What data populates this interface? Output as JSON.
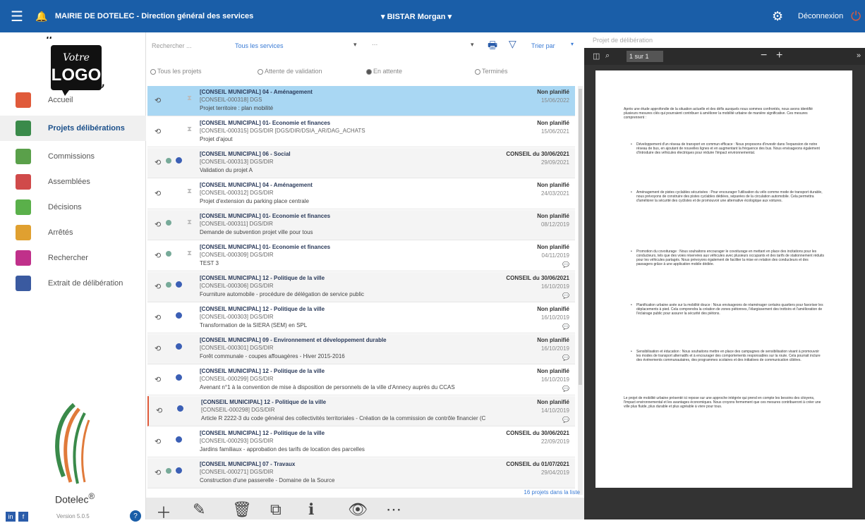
{
  "topbar": {
    "title": "MAIRIE DE DOTELEC - Direction général des services",
    "user": "BISTAR Morgan",
    "logout": "Déconnexion"
  },
  "logo": {
    "line1": "Votre",
    "line2": "LOGO"
  },
  "nav": [
    {
      "label": "Accueil",
      "icon": "home-icon",
      "color": "#e05a3a"
    },
    {
      "label": "Projets délibérations",
      "icon": "factory-icon",
      "color": "#3a8a4a",
      "active": true
    },
    {
      "label": "Commissions",
      "icon": "group-icon",
      "color": "#5aa04a"
    },
    {
      "label": "Assemblées",
      "icon": "assembly-icon",
      "color": "#d04a4a"
    },
    {
      "label": "Décisions",
      "icon": "decision-icon",
      "color": "#5ab04a"
    },
    {
      "label": "Arrêtés",
      "icon": "arrete-icon",
      "color": "#e0a030"
    },
    {
      "label": "Rechercher",
      "icon": "search-icon",
      "color": "#c0308a"
    },
    {
      "label": "Extrait de délibération",
      "icon": "extract-icon",
      "color": "#3a5aa0"
    }
  ],
  "brand": "Dotelec",
  "version": "Version 5.0.5",
  "filters": {
    "search_placeholder": "Rechercher ...",
    "services": "Tous les services",
    "sort": "Trier par",
    "radios": [
      {
        "label": "Tous les projets",
        "checked": false
      },
      {
        "label": "Attente de validation",
        "checked": false
      },
      {
        "label": "En attente",
        "checked": true
      },
      {
        "label": "Terminés",
        "checked": false
      }
    ]
  },
  "rows": [
    {
      "t1": "[CONSEIL MUNICIPAL] 04 - Aménagement",
      "t2": "[CONSEIL-000318] DGS",
      "t3": "Projet territoire : plan mobilité",
      "st": "Non planifié",
      "dt": "15/06/2022",
      "sel": true,
      "i2": false,
      "i3": false,
      "hour": true
    },
    {
      "t1": "[CONSEIL MUNICIPAL] 01- Economie et finances",
      "t2": "[CONSEIL-000315] DGS/DIR [DGS/DIR/DSIA_AR/DAG_ACHATS",
      "t3": "Projet d'ajout",
      "st": "Non planifié",
      "dt": "15/06/2021",
      "i2": false,
      "i3": false,
      "hour": true
    },
    {
      "t1": "[CONSEIL MUNICIPAL] 06 - Social",
      "t2": "[CONSEIL-000313] DGS/DIR",
      "t3": "Validation du projet A",
      "st": "CONSEIL du 30/06/2021",
      "dt": "29/09/2021",
      "alt": true,
      "i2": true,
      "i3": true,
      "hour": false
    },
    {
      "t1": "[CONSEIL MUNICIPAL] 04 - Aménagement",
      "t2": "[CONSEIL-000312] DGS/DIR",
      "t3": "Projet d'extension du parking place centrale",
      "st": "Non planifié",
      "dt": "24/03/2021",
      "i2": false,
      "i3": false,
      "hour": true
    },
    {
      "t1": "[CONSEIL MUNICIPAL] 01- Economie et finances",
      "t2": "[CONSEIL-000311] DGS/DIR",
      "t3": "Demande de subvention projet ville pour tous",
      "st": "Non planifié",
      "dt": "08/12/2019",
      "alt": true,
      "i2": true,
      "i3": false,
      "hour": true
    },
    {
      "t1": "[CONSEIL MUNICIPAL] 01- Economie et finances",
      "t2": "[CONSEIL-000309] DGS/DIR",
      "t3": "TEST 3",
      "st": "Non planifié",
      "dt": "04/11/2019",
      "cm": true,
      "i2": true,
      "i3": false,
      "hour": true
    },
    {
      "t1": "[CONSEIL MUNICIPAL] 12 - Politique de la ville",
      "t2": "[CONSEIL-000306] DGS/DIR",
      "t3": "Fourniture automobile - procédure de délégation de service public",
      "st": "CONSEIL du 30/06/2021",
      "dt": "16/10/2019",
      "cm": true,
      "alt": true,
      "i2": true,
      "i3": true,
      "hour": false
    },
    {
      "t1": "[CONSEIL MUNICIPAL] 12 - Politique de la ville",
      "t2": "[CONSEIL-000303] DGS/DIR",
      "t3": "Transformation de la SIERA (SEM) en SPL",
      "st": "Non planifié",
      "dt": "16/10/2019",
      "cm": true,
      "i2": false,
      "i3": true,
      "hour": false
    },
    {
      "t1": "[CONSEIL MUNICIPAL] 09 - Environnement et développement durable",
      "t2": "[CONSEIL-000301] DGS/DIR",
      "t3": "Forêt communale - coupes affouagères - Hiver 2015-2016",
      "st": "Non planifié",
      "dt": "16/10/2019",
      "cm": true,
      "alt": true,
      "i2": false,
      "i3": true,
      "hour": false
    },
    {
      "t1": "[CONSEIL MUNICIPAL] 12 - Politique de la ville",
      "t2": "[CONSEIL-000299] DGS/DIR",
      "t3": "Avenant n°1 à la convention de mise à disposition de personnels de la ville d'Annecy auprès du CCAS",
      "st": "Non planifié",
      "dt": "16/10/2019",
      "cm": true,
      "i2": false,
      "i3": true,
      "hour": false
    },
    {
      "t1": "[CONSEIL MUNICIPAL] 12 - Politique de la ville",
      "t2": "[CONSEIL-000298] DGS/DIR",
      "t3": "Article R 2222-3 du code général des collectivités territoriales - Création de la commission de contrôle financier (C",
      "st": "Non planifié",
      "dt": "14/10/2019",
      "cm": true,
      "alt": true,
      "red": true,
      "i2": false,
      "i3": true,
      "hour": false
    },
    {
      "t1": "[CONSEIL MUNICIPAL] 12 - Politique de la ville",
      "t2": "[CONSEIL-000293] DGS/DIR",
      "t3": "Jardins familiaux - approbation des tarifs de location des parcelles",
      "st": "CONSEIL du 30/06/2021",
      "dt": "22/09/2019",
      "i2": false,
      "i3": true,
      "hour": false
    },
    {
      "t1": "[CONSEIL MUNICIPAL] 07 - Travaux",
      "t2": "[CONSEIL-000271] DGS/DIR",
      "t3": "Construction d'une passerelle - Domaine de la Source",
      "st": "CONSEIL du 01/07/2021",
      "dt": "29/04/2019",
      "alt": true,
      "i2": true,
      "i3": true,
      "hour": false
    }
  ],
  "count": "16 projets dans la liste",
  "viewer": {
    "title": "Projet de délibération",
    "page": "1",
    "of": "sur 1",
    "intro": "Après une étude approfondie de la situation actuelle et des défis auxquels nous sommes confrontés, nous avons identifié plusieurs mesures clés qui pourraient contribuer à améliorer la mobilité urbaine de manière significative. Ces mesures comprennent :",
    "bullets": [
      "Développement d'un réseau de transport en commun efficace : Nous proposons d'investir dans l'expansion de notre réseau de bus, en ajoutant de nouvelles lignes et en augmentant la fréquence des bus. Nous envisageons également d'introduire des véhicules électriques pour réduire l'impact environnemental.",
      "Aménagement de pistes cyclables sécurisées : Pour encourager l'utilisation du vélo comme mode de transport durable, nous prévoyons de construire des pistes cyclables dédiées, séparées de la circulation automobile. Cela permettra d'améliorer la sécurité des cyclistes et de promouvoir une alternative écologique aux voitures.",
      "Promotion du covoiturage : Nous souhaitons encourager le covoiturage en mettant en place des incitations pour les conducteurs, tels que des voies réservées aux véhicules avec plusieurs occupants et des tarifs de stationnement réduits pour les véhicules partagés. Nous prévoyons également de faciliter la mise en relation des conducteurs et des passagers grâce à une application mobile dédiée.",
      "Planification urbaine axée sur la mobilité douce : Nous envisageons de réaménager certains quartiers pour favoriser les déplacements à pied. Cela comprendra la création de zones piétonnes, l'élargissement des trottoirs et l'amélioration de l'éclairage public pour assurer la sécurité des piétons.",
      "Sensibilisation et éducation : Nous souhaitons mettre en place des campagnes de sensibilisation visant à promouvoir les modes de transport alternatifs et à encourager des comportements responsables sur la route. Cela pourrait inclure des événements communautaires, des programmes scolaires et des initiatives de communication ciblées."
    ],
    "outro": "Le projet de mobilité urbaine présenté ici repose sur une approche intégrée qui prend en compte les besoins des citoyens, l'impact environnemental et les avantages économiques. Nous croyons fermement que ces mesures contribueront à créer une ville plus fluide, plus durable et plus agréable à vivre pour tous."
  }
}
